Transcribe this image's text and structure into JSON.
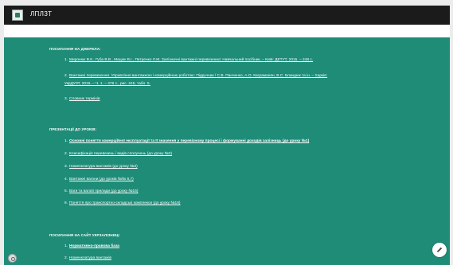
{
  "app": {
    "title": "ЛПЛЗТ"
  },
  "sections": [
    {
      "title": "ПОСИЛАННЯ НА ДЖЕРЕЛА:",
      "items": [
        {
          "num": "1.",
          "text": "Миронюк В.К., Губа В.В., Мацюк В.І., Петренко Л.М. Залізничні вантажні перевезення: Навчальний посібник. – Київ: ДЕТУТ, 2015. – 248 с."
        },
        {
          "num": "2.",
          "text": "Вантажні перевезення. Управління вантажною і комерційною роботою: Підручник / С.В. Панченко, А.О. Каграманян, В.С. Блиндюк та ін. – Харків:"
        },
        {
          "num": "",
          "text": "УкрДУЗТ, 2016. – Ч. 1. – 476 с., рис. 245, табл. 5."
        },
        {
          "num": "3.",
          "text": "Словник термінів"
        }
      ]
    },
    {
      "title": "ПРЕЗЕНТАЦІЇ ДО УРОКІВ:",
      "items": [
        {
          "num": "1.",
          "text": "Основні поняття комерційної експлуатації та її значення у перевізному процесі і формуванні доходів залізниць (до уроку №1)"
        },
        {
          "num": "2.",
          "text": "Класифікація перевезень і видів сполучень (до уроку №2)"
        },
        {
          "num": "3.",
          "text": "Номенклатура вантажів (до уроку №3)"
        },
        {
          "num": "4.",
          "text": "Вантажні вагони (до уроків №№ 6,7)"
        },
        {
          "num": "5.",
          "text": "Ваги та вагові прилади (до уроку №15)"
        },
        {
          "num": "6.",
          "text": "Поняття про транспортно-складські комплекси (до уроку №18)"
        }
      ]
    },
    {
      "title": "ПОСИЛАННЯ НА САЙТ УКРЗАЛІЗНИЦІ",
      "items": [
        {
          "num": "1.",
          "text": "Нормативно-правова база"
        },
        {
          "num": "2.",
          "text": "Номенклатура вантажів"
        }
      ]
    }
  ],
  "icons": {
    "left_fab": "settings-circle-icon",
    "right_fab": "pencil-edit-icon"
  }
}
